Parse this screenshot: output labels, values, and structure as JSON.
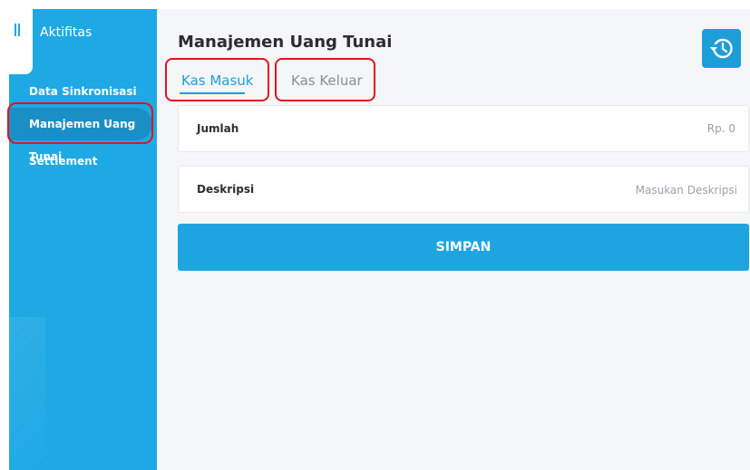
{
  "sidebar": {
    "title": "Aktifitas",
    "items": [
      {
        "label": "Data Sinkronisasi",
        "active": false
      },
      {
        "label": "Manajemen Uang Tunai",
        "active": true
      },
      {
        "label": "Settlement",
        "active": false
      }
    ]
  },
  "main": {
    "title": "Manajemen Uang Tunai",
    "tabs": [
      {
        "label": "Kas Masuk",
        "active": true
      },
      {
        "label": "Kas Keluar",
        "active": false
      }
    ],
    "fields": {
      "amount": {
        "label": "Jumlah",
        "value": "Rp. 0"
      },
      "description": {
        "label": "Deskripsi",
        "placeholder": "Masukan Deskripsi"
      }
    },
    "save_label": "SIMPAN"
  },
  "icons": {
    "history": "history-icon",
    "menu_handle": "menu-handle-icon"
  },
  "colors": {
    "sidebar": "#1ea9e4",
    "sidebar_active": "#1a8fc6",
    "accent": "#1ea5e0",
    "highlight_outline": "#e3121d",
    "background": "#f5f6f7"
  }
}
